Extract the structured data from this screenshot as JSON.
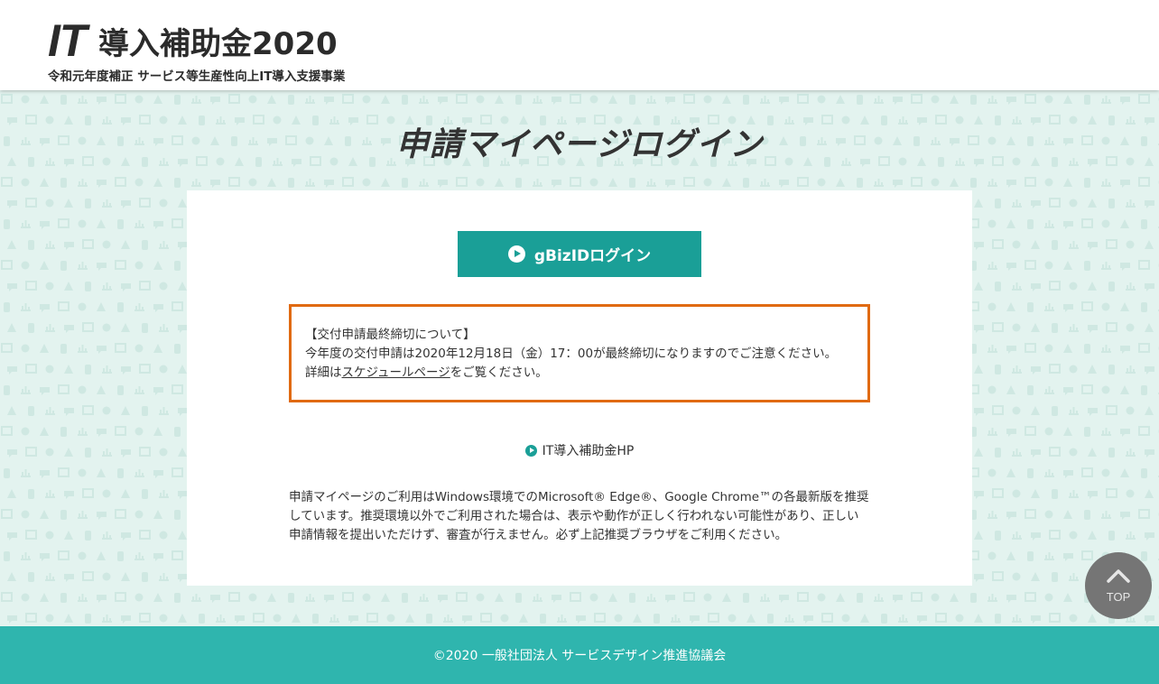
{
  "header": {
    "logo_it": "IT",
    "logo_main": "導入補助金2020",
    "logo_subtitle": "令和元年度補正 サービス等生産性向上IT導入支援事業"
  },
  "page_title": "申請マイページログイン",
  "login_button": {
    "icon": "play-circle-icon",
    "label": "gBizIDログイン"
  },
  "notice": {
    "heading": "【交付申請最終締切について】",
    "line1": "今年度の交付申請は2020年12月18日（金）17：00が最終締切になりますのでご注意ください。",
    "line2_prefix": "詳細は",
    "line2_link": "スケジュールページ",
    "line2_suffix": "をご覧ください。"
  },
  "hp_link": {
    "icon": "play-circle-icon",
    "label": "IT導入補助金HP"
  },
  "recommend_text": "申請マイページのご利用はWindows環境でのMicrosoft® Edge®、Google Chrome™の各最新版を推奨しています。推奨環境以外でご利用された場合は、表示や動作が正しく行われない可能性があり、正しい申請情報を提出いただけず、審査が行えません。必ず上記推奨ブラウザをご利用ください。",
  "footer": {
    "copyright": "©2020 一般社団法人 サービスデザイン推進協議会"
  },
  "back_to_top": {
    "icon": "chevron-up-icon",
    "label": "TOP"
  },
  "colors": {
    "accent_teal": "#1a9f97",
    "footer_teal": "#2fb5ae",
    "notice_border": "#e06a12",
    "pattern_bg": "#e3f3ef",
    "top_button": "#757575"
  }
}
